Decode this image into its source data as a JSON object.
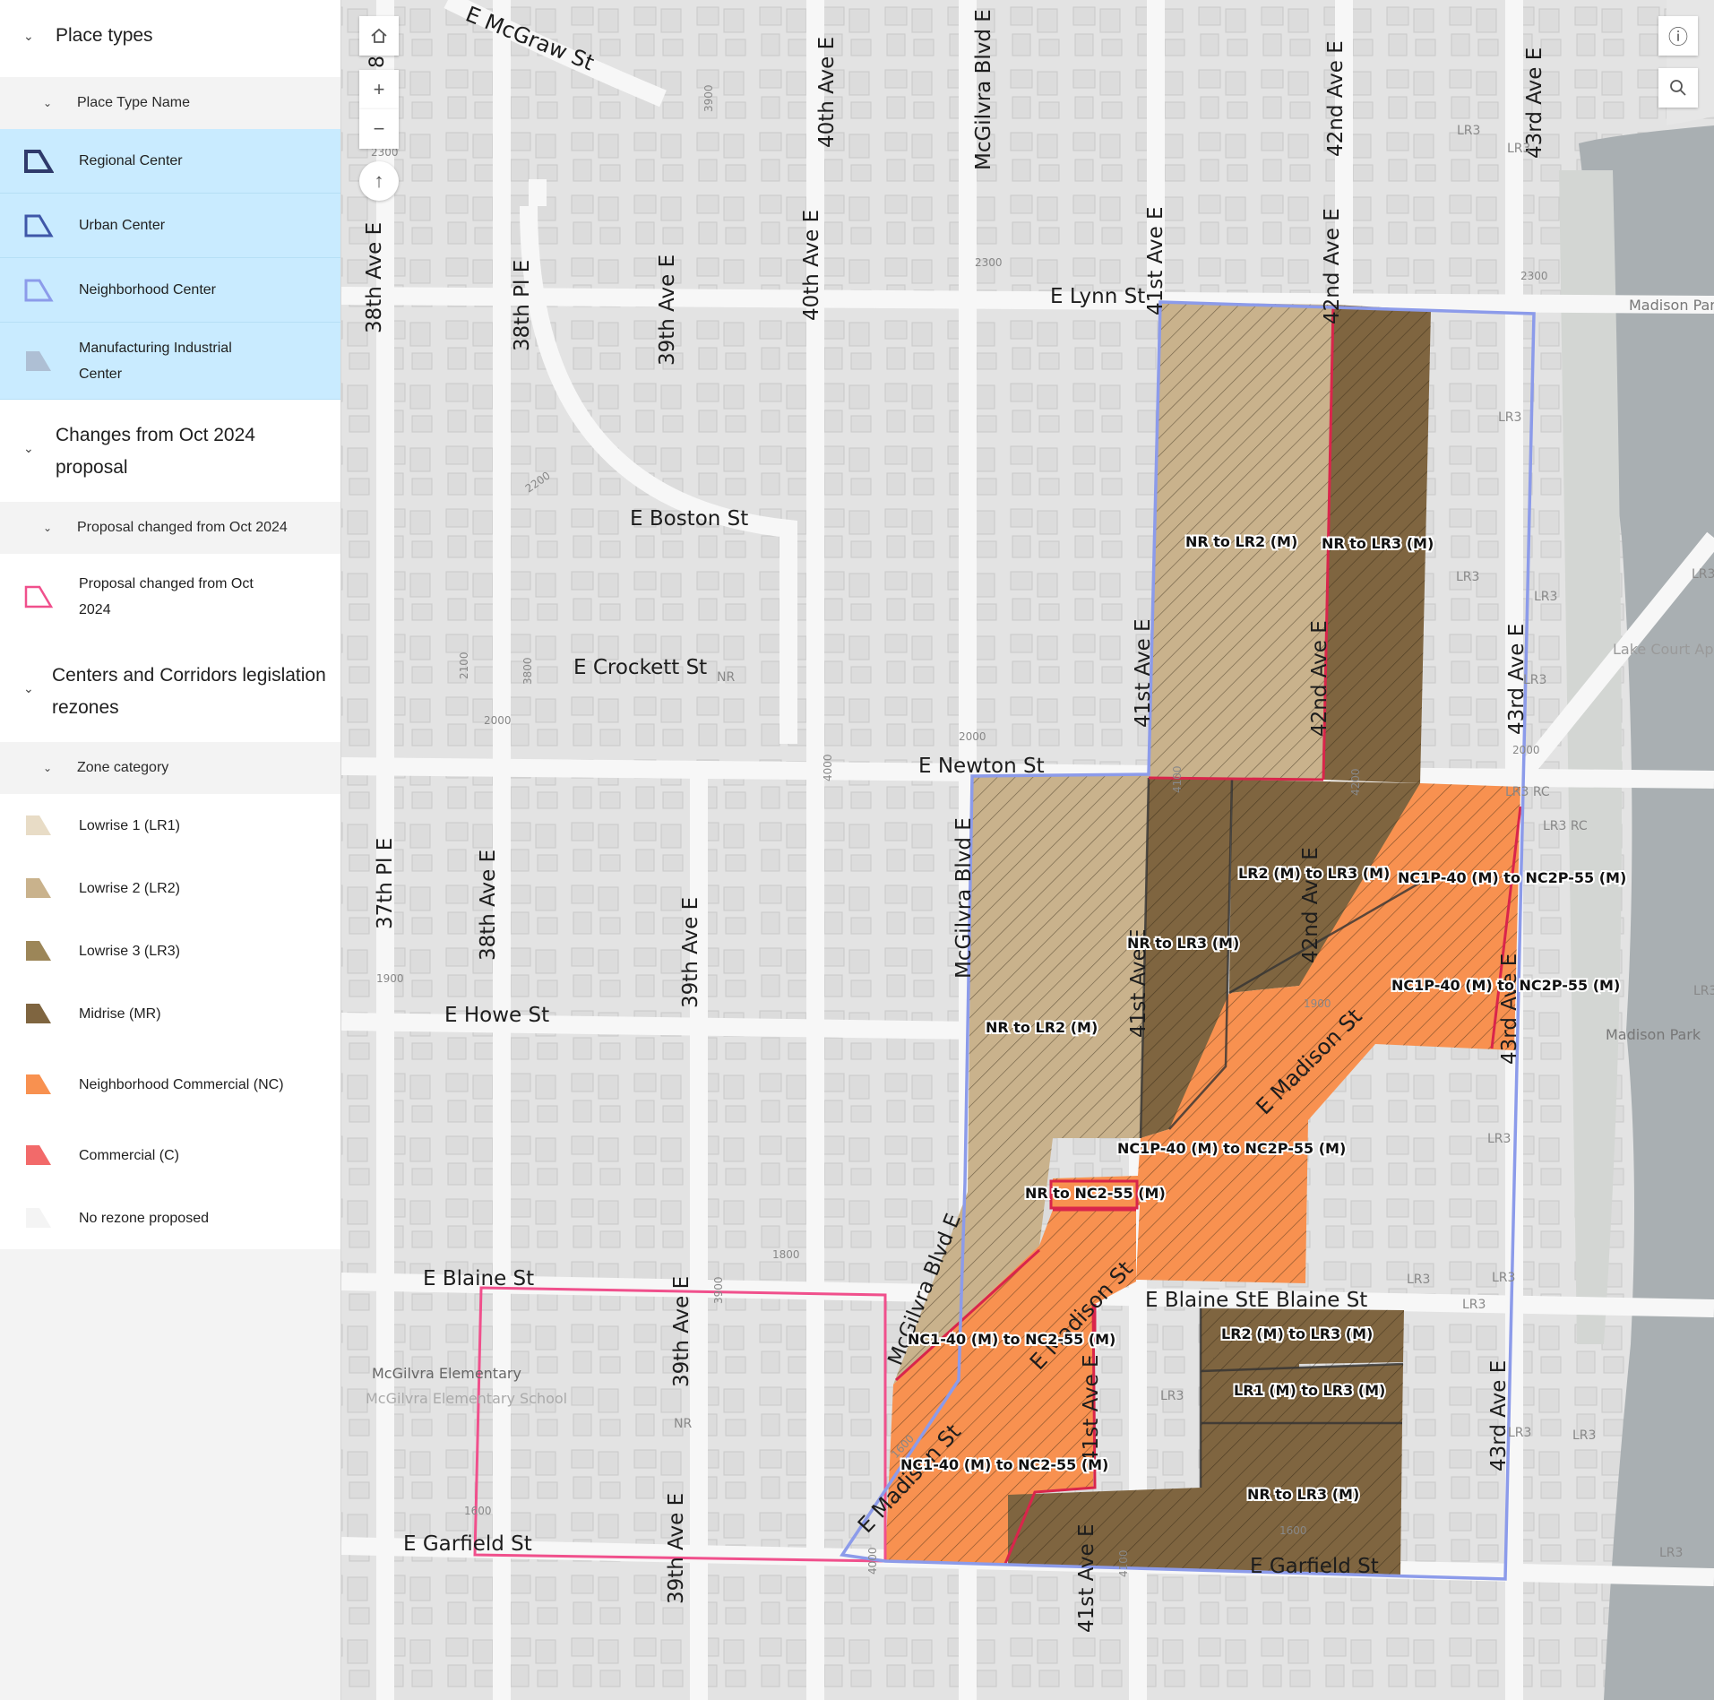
{
  "legend": {
    "place_types": {
      "title": "Place types",
      "sub_title": "Place Type Name",
      "items": [
        {
          "label": "Regional Center"
        },
        {
          "label": "Urban Center"
        },
        {
          "label": "Neighborhood Center"
        },
        {
          "label": "Manufacturing Industrial Center"
        }
      ]
    },
    "changes": {
      "title": "Changes from Oct 2024 proposal",
      "sub_title": "Proposal changed from Oct 2024",
      "items": [
        {
          "label": "Proposal changed from Oct 2024"
        }
      ]
    },
    "rezones": {
      "title": "Centers and Corridors legislation rezones",
      "sub_title": "Zone category",
      "items": [
        {
          "label": "Lowrise 1 (LR1)"
        },
        {
          "label": "Lowrise 2 (LR2)"
        },
        {
          "label": "Lowrise 3 (LR3)"
        },
        {
          "label": "Midrise (MR)"
        },
        {
          "label": "Neighborhood Commercial (NC)"
        },
        {
          "label": "Commercial (C)"
        },
        {
          "label": "No rezone proposed"
        }
      ]
    }
  },
  "colors": {
    "regional_center": "#2f3a6b",
    "urban_center": "#3f57a8",
    "neighborhood_center": "#8c9bea",
    "manufacturing": "#aebfd4",
    "changed": "#f0508c",
    "lr1": "#e8dcc6",
    "lr2": "#c9b28c",
    "lr3": "#9c8658",
    "mr": "#7f6540",
    "nc": "#f89150",
    "c": "#f26a6a",
    "no_rezone": "#f4f4f4",
    "selected_bg": "#c9ebff"
  },
  "map": {
    "controls": {
      "home": "home-icon",
      "zoom_in": "+",
      "zoom_out": "−",
      "compass": "↑",
      "info": "ⓘ",
      "search": "search-icon"
    },
    "streets": [
      {
        "id": "mcgraw",
        "text": "E McGraw St"
      },
      {
        "id": "lynn",
        "text": "E Lynn St"
      },
      {
        "id": "boston",
        "text": "E Boston St"
      },
      {
        "id": "crockett",
        "text": "E Crockett St"
      },
      {
        "id": "newton",
        "text": "E Newton St"
      },
      {
        "id": "howe",
        "text": "E Howe St"
      },
      {
        "id": "blaine_w",
        "text": "E Blaine St"
      },
      {
        "id": "blaine_e",
        "text": "E Blaine StE Blaine St"
      },
      {
        "id": "garfield_w",
        "text": "E Garfield St"
      },
      {
        "id": "garfield_e",
        "text": "E Garfield St"
      },
      {
        "id": "a38",
        "text": "38th Ave E"
      },
      {
        "id": "p38",
        "text": "38th Pl E"
      },
      {
        "id": "a39",
        "text": "39th Ave E"
      },
      {
        "id": "a40",
        "text": "40th Ave E"
      },
      {
        "id": "a40b",
        "text": "40th Ave E"
      },
      {
        "id": "mcg1",
        "text": "McGilvra Blvd E"
      },
      {
        "id": "mcg2",
        "text": "McGilvra Blvd E"
      },
      {
        "id": "mcg3",
        "text": "McGilvra Blvd E"
      },
      {
        "id": "a41",
        "text": "41st Ave E"
      },
      {
        "id": "a41b",
        "text": "41st Ave E"
      },
      {
        "id": "a41c",
        "text": "41st Ave E"
      },
      {
        "id": "a41d",
        "text": "41st Ave E"
      },
      {
        "id": "a41e",
        "text": "41st Ave E"
      },
      {
        "id": "a42",
        "text": "42nd Ave E"
      },
      {
        "id": "a42b",
        "text": "42nd Ave E"
      },
      {
        "id": "a42c",
        "text": "42nd Ave E"
      },
      {
        "id": "a42d",
        "text": "42nd Ave E"
      },
      {
        "id": "a43",
        "text": "43rd Ave E"
      },
      {
        "id": "a43b",
        "text": "43rd Ave E"
      },
      {
        "id": "a43c",
        "text": "43rd Ave E"
      },
      {
        "id": "a43d",
        "text": "43rd Ave E"
      },
      {
        "id": "p37",
        "text": "37th Pl E"
      },
      {
        "id": "a38b",
        "text": "38th Ave E"
      },
      {
        "id": "a39b",
        "text": "39th Ave E"
      },
      {
        "id": "a39c",
        "text": "39th Ave E"
      },
      {
        "id": "a39d",
        "text": "39th Ave E"
      },
      {
        "id": "mad1",
        "text": "E Madison St"
      },
      {
        "id": "mad2",
        "text": "E Madison St"
      },
      {
        "id": "mad3",
        "text": "E Madison St"
      },
      {
        "id": "ve",
        "text": "8 ve"
      }
    ],
    "zones": [
      {
        "id": "z1",
        "text": "NR to LR2 (M)"
      },
      {
        "id": "z2",
        "text": "NR to LR3 (M)"
      },
      {
        "id": "z3",
        "text": "LR2 (M) to LR3 (M)"
      },
      {
        "id": "z4",
        "text": "NC1P-40 (M) to NC2P-55 (M)"
      },
      {
        "id": "z5",
        "text": "NR to LR3 (M)"
      },
      {
        "id": "z6",
        "text": "NC1P-40 (M) to NC2P-55 (M)"
      },
      {
        "id": "z7",
        "text": "NR to LR2 (M)"
      },
      {
        "id": "z8",
        "text": "NC1P-40 (M) to NC2P-55 (M)"
      },
      {
        "id": "z9",
        "text": "NR to NC2-55 (M)"
      },
      {
        "id": "z10",
        "text": "NC1-40 (M) to NC2-55 (M)"
      },
      {
        "id": "z11",
        "text": "LR2 (M) to LR3 (M)"
      },
      {
        "id": "z12",
        "text": "LR1 (M) to LR3 (M)"
      },
      {
        "id": "z13",
        "text": "NC1-40 (M) to NC2-55 (M)"
      },
      {
        "id": "z14",
        "text": "NR to LR3 (M)"
      }
    ],
    "small_labels": [
      {
        "id": "s1",
        "text": "LR3"
      },
      {
        "id": "s2",
        "text": "LR3"
      },
      {
        "id": "s3",
        "text": "LR3"
      },
      {
        "id": "s4",
        "text": "LR3"
      },
      {
        "id": "s5",
        "text": "LR3"
      },
      {
        "id": "s6",
        "text": "LR3"
      },
      {
        "id": "s7",
        "text": "LR3"
      },
      {
        "id": "s8",
        "text": "LR3 RC"
      },
      {
        "id": "s9",
        "text": "LR3 RC"
      },
      {
        "id": "s10",
        "text": "LR3"
      },
      {
        "id": "s11",
        "text": "LR3"
      },
      {
        "id": "s12",
        "text": "LR3"
      },
      {
        "id": "s13",
        "text": "LR3"
      },
      {
        "id": "s14",
        "text": "LR3"
      },
      {
        "id": "s15",
        "text": "LR3"
      },
      {
        "id": "s16",
        "text": "LR3"
      },
      {
        "id": "s17",
        "text": "NR"
      },
      {
        "id": "s18",
        "text": "NR"
      },
      {
        "id": "s19",
        "text": "LR3"
      },
      {
        "id": "s20",
        "text": "LR3"
      }
    ],
    "numbers": [
      {
        "id": "n1",
        "text": "3900"
      },
      {
        "id": "n2",
        "text": "2300"
      },
      {
        "id": "n3",
        "text": "2300"
      },
      {
        "id": "n4",
        "text": "2300"
      },
      {
        "id": "n5",
        "text": "2200"
      },
      {
        "id": "n6",
        "text": "2100"
      },
      {
        "id": "n7",
        "text": "3800"
      },
      {
        "id": "n8",
        "text": "2000"
      },
      {
        "id": "n9",
        "text": "2000"
      },
      {
        "id": "n10",
        "text": "2000"
      },
      {
        "id": "n11",
        "text": "4000"
      },
      {
        "id": "n12",
        "text": "4100"
      },
      {
        "id": "n13",
        "text": "4200"
      },
      {
        "id": "n14",
        "text": "1900"
      },
      {
        "id": "n15",
        "text": "1900"
      },
      {
        "id": "n16",
        "text": "1800"
      },
      {
        "id": "n17",
        "text": "3900"
      },
      {
        "id": "n18",
        "text": "1600"
      },
      {
        "id": "n19",
        "text": "1600"
      },
      {
        "id": "n20",
        "text": "1600"
      },
      {
        "id": "n21",
        "text": "4000"
      },
      {
        "id": "n22",
        "text": "4100"
      }
    ],
    "pois": [
      {
        "id": "p1",
        "text": "Madison Park North Beach"
      },
      {
        "id": "p2",
        "text": "Lake Court Apartments"
      },
      {
        "id": "p3",
        "text": "Madison Park"
      },
      {
        "id": "p4",
        "text": "McGilvra Elementary"
      },
      {
        "id": "p5",
        "text": "McGilvra Elementary School"
      }
    ]
  }
}
